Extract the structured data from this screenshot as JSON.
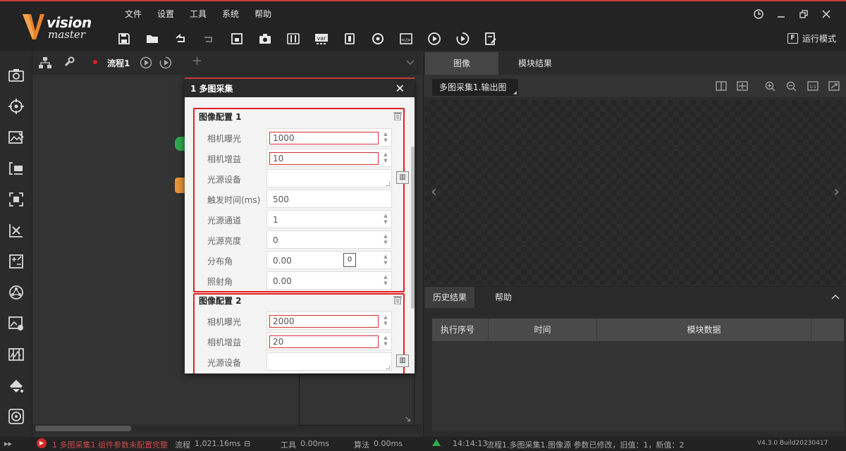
{
  "app": {
    "logo_vision": "vision",
    "logo_master": "master",
    "brand_color": "#e8832a",
    "accent_color": "#c83c3c"
  },
  "menu": [
    "文件",
    "设置",
    "工具",
    "系统",
    "帮助"
  ],
  "toolbar_icons": [
    "save-icon",
    "open-folder-icon",
    "undo-icon",
    "redo-icon",
    "lock-icon",
    "camera-icon",
    "controller-icon",
    "variable-icon",
    "communication-icon",
    "global-script-icon",
    "code-icon",
    "run-once-icon",
    "run-loop-icon",
    "form-icon"
  ],
  "run_mode": {
    "label": "运行模式"
  },
  "sidebar_icons": [
    "image-capture-icon",
    "locate-icon",
    "measure-icon",
    "recognition-icon",
    "calibrate-icon",
    "align-icon",
    "compute-icon",
    "logic-icon",
    "image-process-icon",
    "color-icon",
    "defect-icon",
    "deep-learning-icon"
  ],
  "flow": {
    "tab_label": "流程1",
    "add": "+"
  },
  "dialog": {
    "title": "1 多图采集",
    "groups": [
      {
        "title": "图像配置 1",
        "rows": [
          {
            "label": "相机曝光",
            "value": "1000"
          },
          {
            "label": "相机增益",
            "value": "10"
          },
          {
            "label": "光源设备",
            "value": ""
          },
          {
            "label": "触发时间(ms)",
            "value": "500"
          },
          {
            "label": "光源通道",
            "value": "1"
          },
          {
            "label": "光源亮度",
            "value": "0"
          },
          {
            "label": "分布角",
            "value": "0.00",
            "mini": "0"
          },
          {
            "label": "照射角",
            "value": "0.00"
          }
        ]
      },
      {
        "title": "图像配置 2",
        "rows": [
          {
            "label": "相机曝光",
            "value": "2000"
          },
          {
            "label": "相机增益",
            "value": "20"
          },
          {
            "label": "光源设备",
            "value": ""
          }
        ]
      }
    ]
  },
  "right_panel": {
    "tabs": [
      "图像",
      "模块结果"
    ],
    "source": "多图采集1.输出图",
    "hist_tabs": [
      "历史结果",
      "帮助"
    ],
    "hist_columns": [
      "执行序号",
      "时间",
      "模块数据"
    ]
  },
  "statusbar": {
    "error_msg": "1 多图采集1 组件参数未配置完整",
    "flow_label": "流程",
    "flow_time": "1,021.16ms",
    "tool_label": "工具",
    "tool_time": "0.00ms",
    "algo_label": "算法",
    "algo_time": "0.00ms",
    "log_time": "14:14:13",
    "log_msg": "流程1.多图采集1.图像源 参数已修改，旧值：1，新值：2",
    "version": "V4.3.0 Build20230417"
  }
}
